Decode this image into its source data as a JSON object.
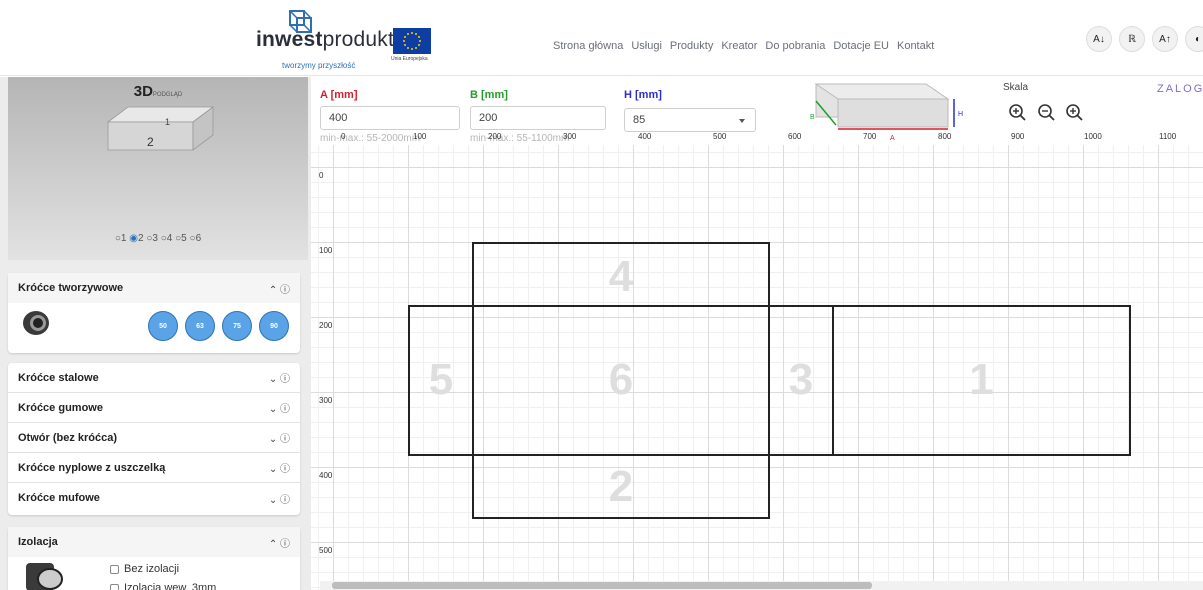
{
  "header": {
    "logo_bold": "inwest",
    "logo_light": "produkt",
    "logo_tagline": "tworzymy przyszłość",
    "eu_caption": "Unia Europejska",
    "nav": [
      "Strona główna",
      "Usługi",
      "Produkty",
      "Kreator",
      "Do pobrania",
      "Dotacje EU",
      "Kontakt"
    ],
    "accessibility": [
      "A↓",
      "ℝ",
      "A↑",
      "◐"
    ]
  },
  "preview": {
    "title": "3D",
    "subtitle": "PODGLĄD",
    "face_labels": [
      "2",
      "1"
    ],
    "views": [
      "1",
      "2",
      "3",
      "4",
      "5",
      "6"
    ],
    "selected_view": "2"
  },
  "sidebar": {
    "plastic": {
      "title": "Króćce tworzywowe",
      "sizes": [
        "50",
        "63",
        "75",
        "90"
      ]
    },
    "collapsed_rows": [
      "Króćce stalowe",
      "Króćce gumowe",
      "Otwór (bez króćca)",
      "Króćce nyplowe z uszczelką",
      "Króćce mufowe"
    ],
    "insulation": {
      "title": "Izolacja",
      "options": [
        "Bez izolacji",
        "Izolacja wew. 3mm"
      ]
    },
    "expand_glyph": "⌄",
    "collapse_glyph": "⌃",
    "info_glyph": "ⓘ"
  },
  "dimensions": {
    "a": {
      "label": "A [mm]",
      "value": "400",
      "hint": "min-max.: 55-2000mm",
      "color": "#d11f2c"
    },
    "b": {
      "label": "B [mm]",
      "value": "200",
      "hint": "min-max.: 55-1100mm",
      "color": "#1f9e2c"
    },
    "h": {
      "label": "H [mm]",
      "value": "85",
      "color": "#2a2fc9"
    }
  },
  "box_labels": {
    "a": "A",
    "b": "B",
    "h": "H"
  },
  "scale": {
    "label": "Skala"
  },
  "login": "ZALOGU",
  "canvas": {
    "x_ticks": [
      "0",
      "100",
      "200",
      "300",
      "400",
      "500",
      "600",
      "700",
      "800",
      "900",
      "1000",
      "1100"
    ],
    "y_ticks": [
      "0",
      "100",
      "200",
      "300",
      "400",
      "500"
    ],
    "panel_numbers": [
      "4",
      "5",
      "6",
      "3",
      "1",
      "2"
    ]
  },
  "colors": {
    "accent": "#59a3e6",
    "login": "#7a6fd6",
    "eu_blue": "#0f3ea3"
  }
}
